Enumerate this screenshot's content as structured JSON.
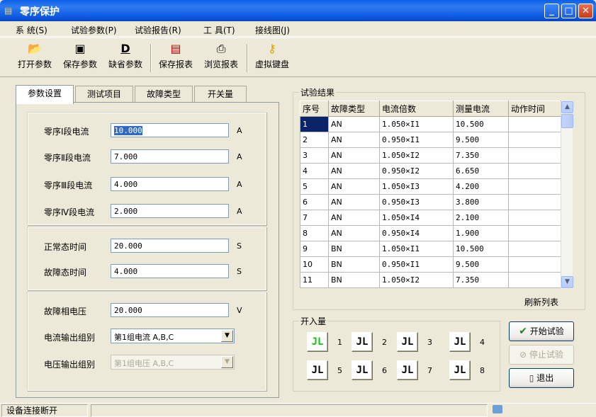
{
  "window": {
    "title": "零序保护",
    "icon": "app-icon"
  },
  "menu": [
    "系 统(S)",
    "试验参数(P)",
    "试验报告(R)",
    "工 具(T)",
    "接线图(J)"
  ],
  "toolbar": [
    {
      "label": "打开参数",
      "icon": "folder-open-icon"
    },
    {
      "label": "保存参数",
      "icon": "floppy-disk-icon"
    },
    {
      "label": "缺省参数",
      "icon": "default-icon"
    },
    {
      "label": "保存报表",
      "icon": "save-report-icon"
    },
    {
      "label": "浏览报表",
      "icon": "printer-icon"
    },
    {
      "label": "虚拟键盘",
      "icon": "key-icon"
    }
  ],
  "tabs": [
    "参数设置",
    "测试项目",
    "故障类型",
    "开关量"
  ],
  "params": {
    "currents": [
      {
        "label": "零序Ⅰ段电流",
        "value": "10.000",
        "unit": "A"
      },
      {
        "label": "零序Ⅱ段电流",
        "value": "7.000",
        "unit": "A"
      },
      {
        "label": "零序Ⅲ段电流",
        "value": "4.000",
        "unit": "A"
      },
      {
        "label": "零序Ⅳ段电流",
        "value": "2.000",
        "unit": "A"
      }
    ],
    "times": [
      {
        "label": "正常态时间",
        "value": "20.000",
        "unit": "S"
      },
      {
        "label": "故障态时间",
        "value": "4.000",
        "unit": "S"
      }
    ],
    "voltage": {
      "label": "故障相电压",
      "value": "20.000",
      "unit": "V"
    },
    "current_group": {
      "label": "电流输出组别",
      "value": "第1组电流 A,B,C"
    },
    "voltage_group": {
      "label": "电压输出组别",
      "value": "第1组电压 A,B,C"
    }
  },
  "results": {
    "caption": "试验结果",
    "columns": [
      "序号",
      "故障类型",
      "电流倍数",
      "测量电流",
      "动作时间"
    ],
    "rows": [
      [
        "1",
        "AN",
        "1.050×I1",
        "10.500",
        ""
      ],
      [
        "2",
        "AN",
        "0.950×I1",
        "9.500",
        ""
      ],
      [
        "3",
        "AN",
        "1.050×I2",
        "7.350",
        ""
      ],
      [
        "4",
        "AN",
        "0.950×I2",
        "6.650",
        ""
      ],
      [
        "5",
        "AN",
        "1.050×I3",
        "4.200",
        ""
      ],
      [
        "6",
        "AN",
        "0.950×I3",
        "3.800",
        ""
      ],
      [
        "7",
        "AN",
        "1.050×I4",
        "2.100",
        ""
      ],
      [
        "8",
        "AN",
        "0.950×I4",
        "1.900",
        ""
      ],
      [
        "9",
        "BN",
        "1.050×I1",
        "10.500",
        ""
      ],
      [
        "10",
        "BN",
        "0.950×I1",
        "9.500",
        ""
      ],
      [
        "11",
        "BN",
        "1.050×I2",
        "7.350",
        ""
      ]
    ],
    "refresh": "刷新列表"
  },
  "inputs": {
    "caption": "开入量",
    "items": [
      {
        "n": "1",
        "on": true
      },
      {
        "n": "2",
        "on": false
      },
      {
        "n": "3",
        "on": false
      },
      {
        "n": "4",
        "on": false
      },
      {
        "n": "5",
        "on": false
      },
      {
        "n": "6",
        "on": false
      },
      {
        "n": "7",
        "on": false
      },
      {
        "n": "8",
        "on": false
      }
    ],
    "glyph": "JL"
  },
  "actions": {
    "start": "开始试验",
    "stop": "停止试验",
    "exit": "退出"
  },
  "status": {
    "text": "设备连接断开"
  },
  "colors": {
    "title_bar": "#0a5fe8",
    "selected": "#0a246a",
    "input_on": "#18c018"
  }
}
